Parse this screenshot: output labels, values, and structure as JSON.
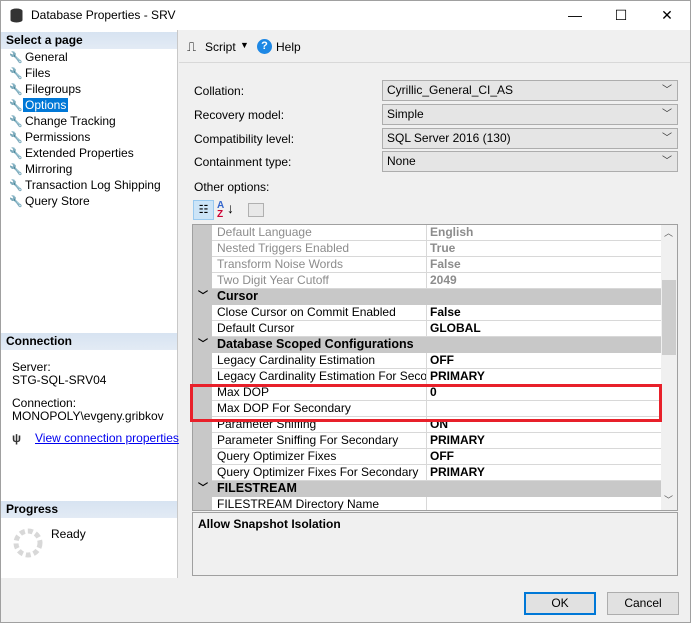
{
  "window": {
    "title": "Database Properties - SRV",
    "minimize": "—",
    "maximize": "☐",
    "close": "✕",
    "icon": "database-icon"
  },
  "left": {
    "select_header": "Select a page",
    "pages": [
      {
        "label": "General"
      },
      {
        "label": "Files"
      },
      {
        "label": "Filegroups"
      },
      {
        "label": "Options",
        "selected": true
      },
      {
        "label": "Change Tracking"
      },
      {
        "label": "Permissions"
      },
      {
        "label": "Extended Properties"
      },
      {
        "label": "Mirroring"
      },
      {
        "label": "Transaction Log Shipping"
      },
      {
        "label": "Query Store"
      }
    ],
    "connection_header": "Connection",
    "server_label": "Server:",
    "server_value": "STG-SQL-SRV04",
    "connection_label": "Connection:",
    "connection_value": "MONOPOLY\\evgeny.gribkov",
    "view_link": "View connection properties",
    "progress_header": "Progress",
    "progress_status": "Ready"
  },
  "toolbar": {
    "script": "Script",
    "help": "Help"
  },
  "form": {
    "collation_label": "Collation:",
    "collation_value": "Cyrillic_General_CI_AS",
    "recovery_label": "Recovery model:",
    "recovery_value": "Simple",
    "compat_label": "Compatibility level:",
    "compat_value": "SQL Server 2016 (130)",
    "containment_label": "Containment type:",
    "containment_value": "None",
    "other_label": "Other options:"
  },
  "grid": {
    "rows": [
      {
        "type": "prop",
        "name": "Default Language",
        "value": "English",
        "disabled": true
      },
      {
        "type": "prop",
        "name": "Nested Triggers Enabled",
        "value": "True",
        "disabled": true
      },
      {
        "type": "prop",
        "name": "Transform Noise Words",
        "value": "False",
        "disabled": true
      },
      {
        "type": "prop",
        "name": "Two Digit Year Cutoff",
        "value": "2049",
        "disabled": true
      },
      {
        "type": "cat",
        "name": "Cursor"
      },
      {
        "type": "prop",
        "name": "Close Cursor on Commit Enabled",
        "value": "False"
      },
      {
        "type": "prop",
        "name": "Default Cursor",
        "value": "GLOBAL"
      },
      {
        "type": "cat",
        "name": "Database Scoped Configurations"
      },
      {
        "type": "prop",
        "name": "Legacy Cardinality Estimation",
        "value": "OFF"
      },
      {
        "type": "prop",
        "name": "Legacy Cardinality Estimation For Secondary",
        "value": "PRIMARY"
      },
      {
        "type": "prop",
        "name": "Max DOP",
        "value": "0"
      },
      {
        "type": "prop",
        "name": "Max DOP For Secondary",
        "value": ""
      },
      {
        "type": "prop",
        "name": "Parameter Sniffing",
        "value": "ON"
      },
      {
        "type": "prop",
        "name": "Parameter Sniffing For Secondary",
        "value": "PRIMARY"
      },
      {
        "type": "prop",
        "name": "Query Optimizer Fixes",
        "value": "OFF"
      },
      {
        "type": "prop",
        "name": "Query Optimizer Fixes For Secondary",
        "value": "PRIMARY"
      },
      {
        "type": "cat",
        "name": "FILESTREAM"
      },
      {
        "type": "prop",
        "name": "FILESTREAM Directory Name",
        "value": ""
      }
    ],
    "description": "Allow Snapshot Isolation",
    "highlight_color": "#e8202a"
  },
  "buttons": {
    "ok": "OK",
    "cancel": "Cancel"
  }
}
